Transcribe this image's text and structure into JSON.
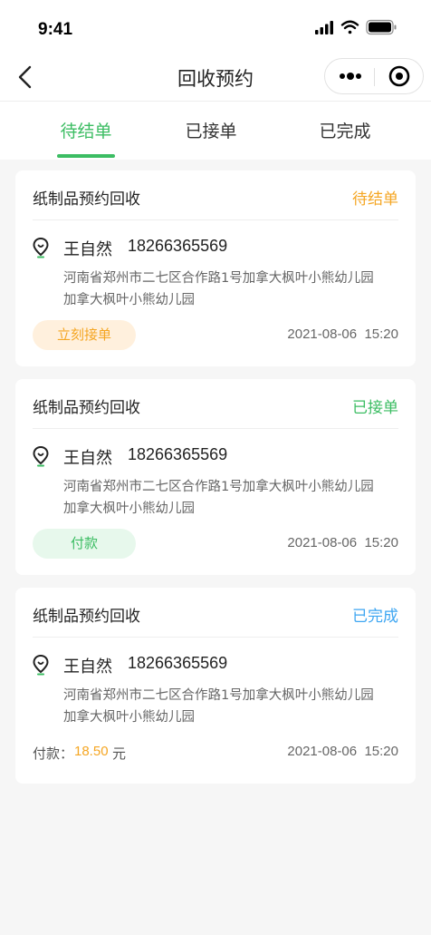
{
  "status_bar": {
    "time": "9:41"
  },
  "nav": {
    "title": "回收预约"
  },
  "tabs": [
    {
      "label": "待结单",
      "active": true
    },
    {
      "label": "已接单",
      "active": false
    },
    {
      "label": "已完成",
      "active": false
    }
  ],
  "colors": {
    "accent_green": "#3cbd63",
    "status_orange": "#f5a623",
    "status_blue": "#3ea6f2",
    "button_orange_bg": "#fff0dd",
    "button_green_bg": "#e7f8ec"
  },
  "cards": [
    {
      "title": "纸制品预约回收",
      "status": "待结单",
      "status_color": "#f5a623",
      "name": "王自然",
      "phone": "18266365569",
      "address_line1": "河南省郑州市二七区合作路1号加拿大枫叶小熊幼儿园",
      "address_line2": "加拿大枫叶小熊幼儿园",
      "time": "2021-08-06  15:20",
      "action_label": "立刻接单"
    },
    {
      "title": "纸制品预约回收",
      "status": "已接单",
      "status_color": "#3cbd63",
      "name": "王自然",
      "phone": "18266365569",
      "address_line1": "河南省郑州市二七区合作路1号加拿大枫叶小熊幼儿园",
      "address_line2": "加拿大枫叶小熊幼儿园",
      "time": "2021-08-06  15:20",
      "action_label": "付款"
    },
    {
      "title": "纸制品预约回收",
      "status": "已完成",
      "status_color": "#3ea6f2",
      "name": "王自然",
      "phone": "18266365569",
      "address_line1": "河南省郑州市二七区合作路1号加拿大枫叶小熊幼儿园",
      "address_line2": "加拿大枫叶小熊幼儿园",
      "time": "2021-08-06  15:20",
      "payment_label": "付款：",
      "payment_amount": "18.50",
      "payment_unit": "元"
    }
  ],
  "icons": {
    "status": [
      "cellular-signal-icon",
      "wifi-icon",
      "battery-icon"
    ],
    "nav": [
      "back-arrow-icon",
      "more-dots-icon",
      "target-icon"
    ],
    "card": "location-pin-icon"
  }
}
